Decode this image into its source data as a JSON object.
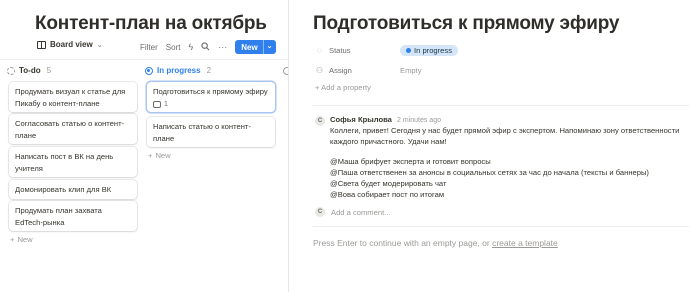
{
  "board": {
    "title": "Контент-план на октябрь",
    "view_label": "Board view",
    "toolbar": {
      "filter": "Filter",
      "sort": "Sort",
      "new": "New"
    },
    "columns": [
      {
        "name": "To-do",
        "count": "5",
        "cards": [
          {
            "text": "Продумать визуал к статье для Пикабу о контент-плане"
          },
          {
            "text": "Согласовать статью о контент-плане"
          },
          {
            "text": "Написать пост в ВК на день учителя"
          },
          {
            "text": "Домонировать клип для ВК"
          },
          {
            "text": "Продумать план захвата EdTech-рынка"
          }
        ],
        "add_label": "New"
      },
      {
        "name": "In progress",
        "count": "2",
        "cards": [
          {
            "text": "Подготовиться к прямому эфиру",
            "comments": "1"
          },
          {
            "text": "Написать статью о контент-плане"
          }
        ],
        "add_label": "New"
      }
    ]
  },
  "page": {
    "title": "Подготовиться к прямому эфиру",
    "properties": {
      "status_label": "Status",
      "status_value": "In progress",
      "assign_label": "Assign",
      "assign_value": "Empty",
      "add_property": "Add a property"
    },
    "comment": {
      "avatar_letter": "С",
      "author": "Софья Крылова",
      "time": "2 minutes ago",
      "lines": [
        "Коллеги, привет! Сегодня у нас будет прямой эфир с экспертом. Напоминаю зону ответственности",
        "каждого причастного. Удачи нам!",
        "@Маша брифует эксперта и готовит вопросы",
        "@Паша ответственен за анонсы в социальных сетях за час до начала (тексты и баннеры)",
        "@Света будет модерировать чат",
        "@Вова собирает пост по итогам"
      ]
    },
    "add_comment_placeholder": "Add a comment...",
    "empty_hint_prefix": "Press Enter to continue with an empty page, or ",
    "empty_hint_link": "create a template"
  },
  "colors": {
    "accent": "#2f80ed",
    "status_bg": "#d3e5f7",
    "muted_text": "#9b9a97",
    "text": "#37352f"
  }
}
